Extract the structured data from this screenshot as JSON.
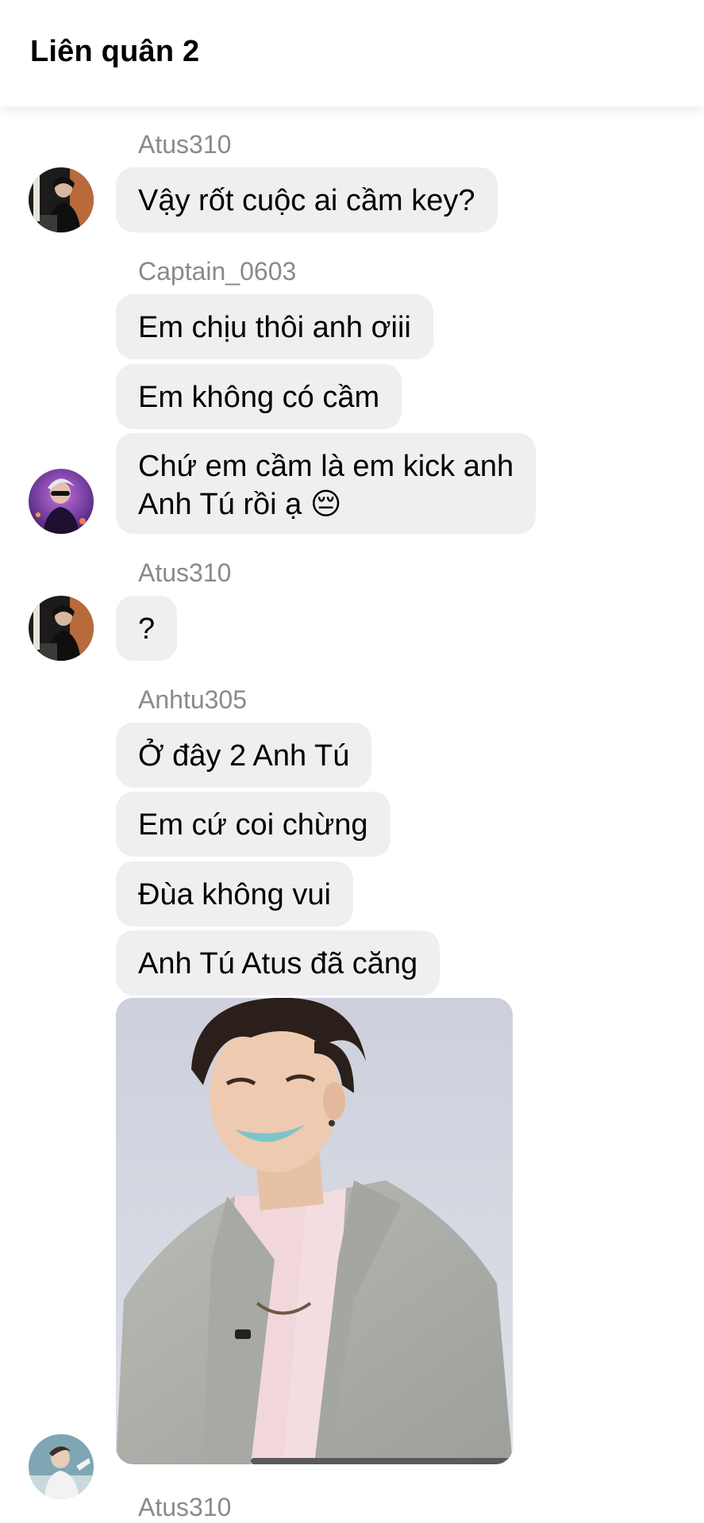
{
  "header": {
    "title": "Liên quân 2"
  },
  "messages": {
    "g1": {
      "sender": "Atus310",
      "texts": [
        "Vậy rốt cuộc ai cầm key?"
      ]
    },
    "g2": {
      "sender": "Captain_0603",
      "texts": [
        "Em chịu thôi anh ơiii",
        "Em không có cầm",
        "Chứ em cầm là em kick anh",
        "Anh Tú rồi ạ 😔"
      ]
    },
    "g3": {
      "sender": "Atus310",
      "texts": [
        "?"
      ]
    },
    "g4": {
      "sender": "Anhtu305",
      "texts": [
        "Ở đây 2 Anh Tú",
        "Em cứ coi chừng",
        "Đùa không vui",
        "Anh Tú Atus đã căng"
      ]
    },
    "g5": {
      "sender": "Atus310"
    }
  },
  "colors": {
    "bubble": "#efeff1",
    "sender_name": "#8a8a8e",
    "background": "#ffffff"
  }
}
